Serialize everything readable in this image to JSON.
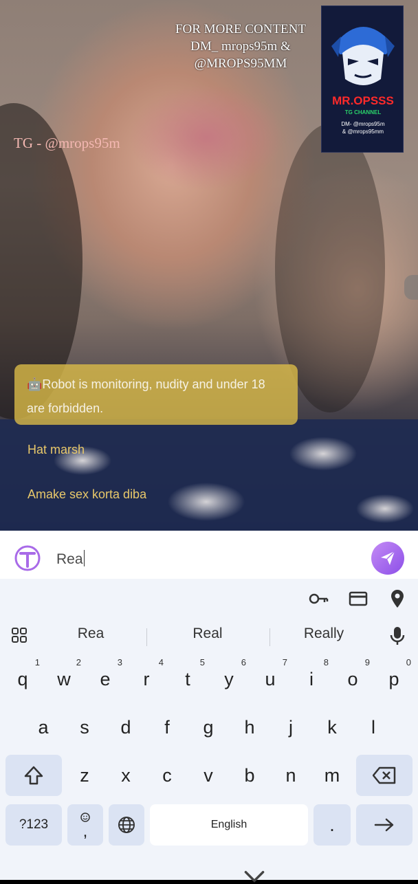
{
  "overlay": {
    "promo_line1": "FOR MORE CONTENT",
    "promo_line2": "DM_ mrops95m &",
    "promo_line3": "@MROPS95MM",
    "tg_handle": "TG - @mrops95m",
    "logo_title": "MR.OPSSS",
    "logo_subtitle": "TG CHANNEL",
    "logo_dm1": "DM- @mrops95m",
    "logo_dm2": "& @mrops95mm"
  },
  "chat": {
    "robot_notice": "🤖Robot is monitoring, nudity and under 18 are forbidden.",
    "comments": [
      "Hat marsh",
      "Amake sex korta diba"
    ]
  },
  "input": {
    "value": "Rea"
  },
  "keyboard": {
    "suggestions": [
      "Rea",
      "Real",
      "Really"
    ],
    "row1": [
      [
        "q",
        "1"
      ],
      [
        "w",
        "2"
      ],
      [
        "e",
        "3"
      ],
      [
        "r",
        "4"
      ],
      [
        "t",
        "5"
      ],
      [
        "y",
        "6"
      ],
      [
        "u",
        "7"
      ],
      [
        "i",
        "8"
      ],
      [
        "o",
        "9"
      ],
      [
        "p",
        "0"
      ]
    ],
    "row2": [
      "a",
      "s",
      "d",
      "f",
      "g",
      "h",
      "j",
      "k",
      "l"
    ],
    "row3": [
      "z",
      "x",
      "c",
      "v",
      "b",
      "n",
      "m"
    ],
    "symbols_label": "?123",
    "comma_label": ",",
    "space_label": "English",
    "period_label": "."
  },
  "colors": {
    "send_button": "#a56af0",
    "keyboard_bg": "#f1f4fa",
    "function_key": "#dbe3f3",
    "robot_notice_bg": "#debe48"
  }
}
